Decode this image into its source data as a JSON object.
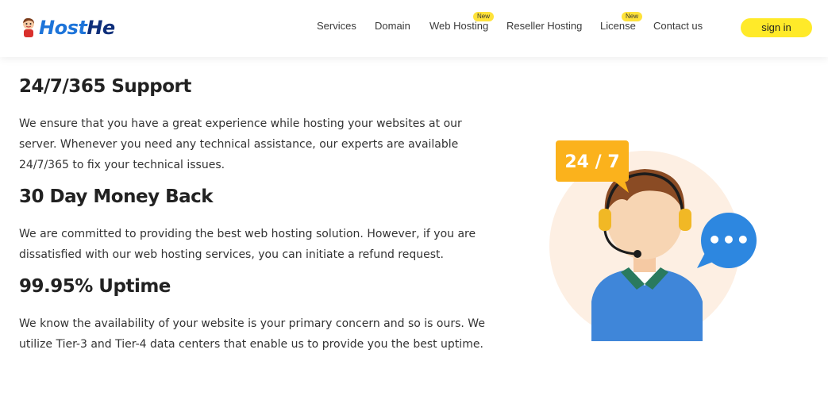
{
  "header": {
    "logo": {
      "part1": "Host",
      "part2": "He"
    },
    "nav": [
      {
        "label": "Services",
        "badge": ""
      },
      {
        "label": "Domain",
        "badge": ""
      },
      {
        "label": "Web Hosting",
        "badge": "New"
      },
      {
        "label": "Reseller Hosting",
        "badge": ""
      },
      {
        "label": "License",
        "badge": "New"
      },
      {
        "label": "Contact us",
        "badge": ""
      }
    ],
    "signin_label": "sign in"
  },
  "sections": [
    {
      "title": "24/7/365 Support",
      "text": "We ensure that you have a great experience while hosting your websites at our server. Whenever you need any technical assistance, our experts are available 24/7/365 to fix your technical issues."
    },
    {
      "title": "30 Day Money Back",
      "text": "We are committed to providing the best web hosting solution. However, if you are dissatisfied with our web hosting services, you can initiate a refund request."
    },
    {
      "title": "99.95% Uptime",
      "text": "We know the availability of your website is your primary concern and so is ours. We utilize Tier-3 and Tier-4 data centers that enable us to provide you the best uptime."
    }
  ],
  "illustration": {
    "badge_text": "24 / 7",
    "chat_dots": "•••"
  },
  "colors": {
    "brand_blue": "#1d74d9",
    "brand_navy": "#0e2f7a",
    "accent_yellow": "#ffea29",
    "badge_orange": "#fbb21c",
    "chat_blue": "#2d87e0"
  }
}
